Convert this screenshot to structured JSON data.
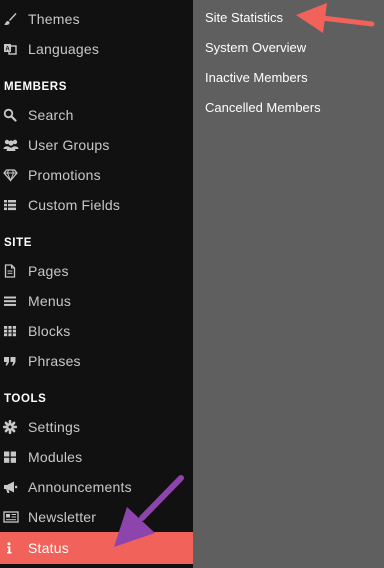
{
  "sidebar": {
    "appearance": [
      {
        "label": "Themes",
        "icon": "brush-icon"
      },
      {
        "label": "Languages",
        "icon": "languages-icon"
      }
    ],
    "members_header": "MEMBERS",
    "members": [
      {
        "label": "Search",
        "icon": "search-icon"
      },
      {
        "label": "User Groups",
        "icon": "users-icon"
      },
      {
        "label": "Promotions",
        "icon": "diamond-icon"
      },
      {
        "label": "Custom Fields",
        "icon": "list-icon"
      }
    ],
    "site_header": "SITE",
    "site": [
      {
        "label": "Pages",
        "icon": "page-icon"
      },
      {
        "label": "Menus",
        "icon": "menu-icon"
      },
      {
        "label": "Blocks",
        "icon": "grid-icon"
      },
      {
        "label": "Phrases",
        "icon": "quote-icon"
      }
    ],
    "tools_header": "TOOLS",
    "tools": [
      {
        "label": "Settings",
        "icon": "gear-icon"
      },
      {
        "label": "Modules",
        "icon": "modules-icon"
      },
      {
        "label": "Announcements",
        "icon": "megaphone-icon"
      },
      {
        "label": "Newsletter",
        "icon": "newspaper-icon"
      },
      {
        "label": "Status",
        "icon": "info-icon",
        "active": true
      }
    ]
  },
  "submenu": {
    "items": [
      "Site Statistics",
      "System Overview",
      "Inactive Members",
      "Cancelled Members"
    ]
  },
  "colors": {
    "sidebar_bg": "#111111",
    "submenu_bg": "#5f5f5f",
    "active_bg": "#f0625a",
    "red_arrow": "#f0625a",
    "purple_arrow": "#8e44ad"
  }
}
